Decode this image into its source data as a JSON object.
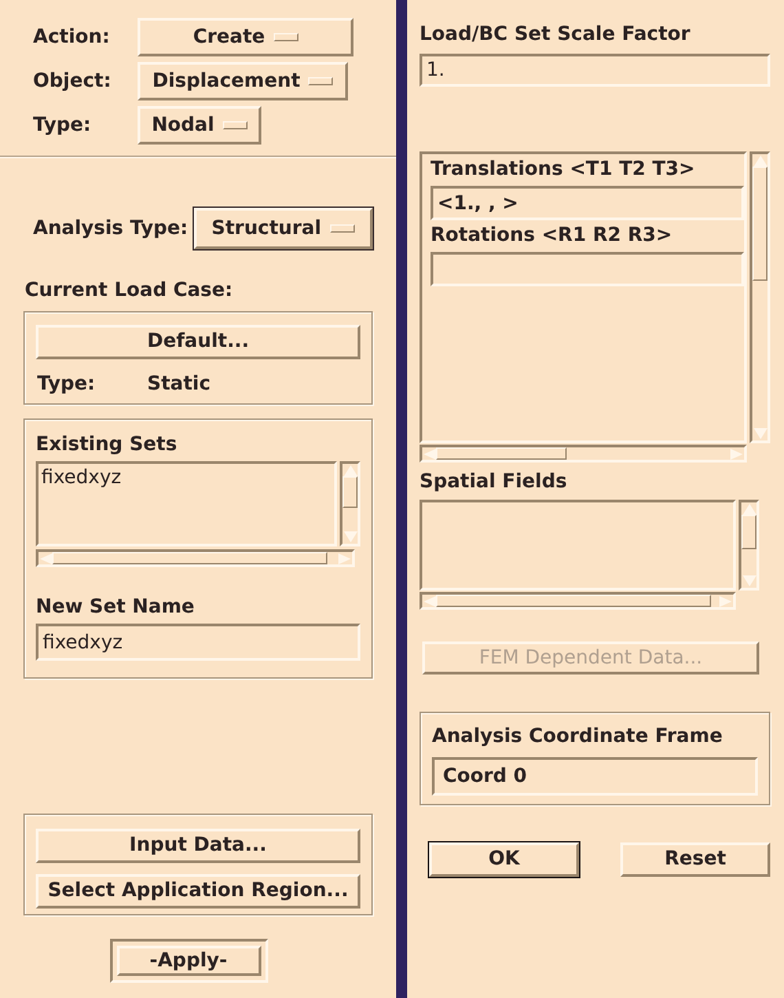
{
  "menus": [
    {
      "label": "Action:",
      "value": "Create"
    },
    {
      "label": "Object:",
      "value": "Displacement"
    },
    {
      "label": "Type:",
      "value": "Nodal"
    }
  ],
  "analysis_type": {
    "label": "Analysis Type:",
    "value": "Structural"
  },
  "load_case": {
    "heading": "Current Load Case:",
    "button": "Default...",
    "type_label": "Type:",
    "type_value": "Static"
  },
  "existing_sets": {
    "heading": "Existing Sets",
    "items": [
      {
        "label": "fixedxyz",
        "selected": false
      }
    ]
  },
  "new_set": {
    "label": "New Set Name",
    "value": "fixedxyz"
  },
  "left_buttons": [
    "Input Data...",
    "Select Application Region..."
  ],
  "apply_button": "-Apply-",
  "scale_factor": {
    "label": "Load/BC Set Scale Factor",
    "value": "1."
  },
  "input_data": [
    {
      "label": "Translations <T1 T2 T3>",
      "value": "<1., , >"
    },
    {
      "label": "Rotations <R1 R2 R3>"
    }
  ],
  "spatial_fields": {
    "heading": "Spatial Fields"
  },
  "fem_button": {
    "label": "FEM Dependent Data...",
    "disabled": true
  },
  "coordinate_frame": {
    "heading": "Analysis Coordinate Frame",
    "value": "Coord 0"
  },
  "dialog_buttons": [
    {
      "label": "OK",
      "default": true
    },
    {
      "label": "Reset",
      "default": false
    }
  ]
}
